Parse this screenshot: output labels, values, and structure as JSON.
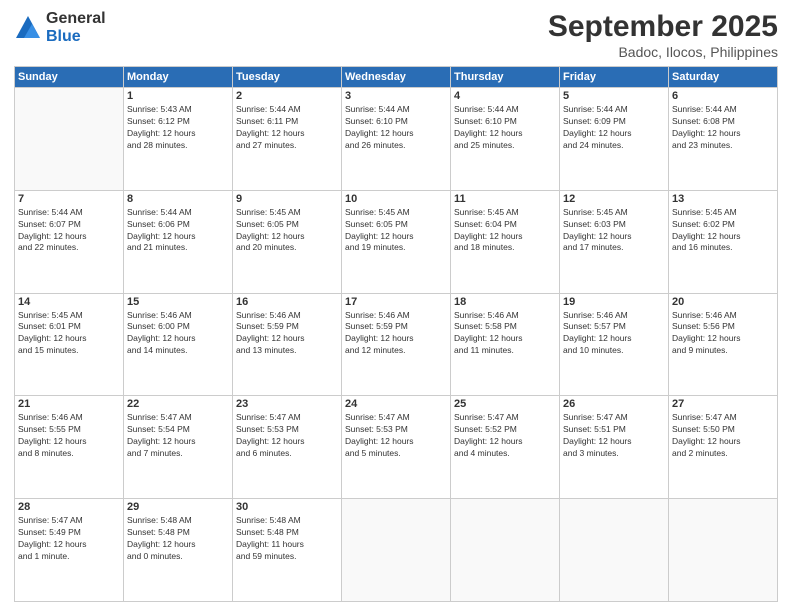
{
  "logo": {
    "general": "General",
    "blue": "Blue"
  },
  "title": "September 2025",
  "location": "Badoc, Ilocos, Philippines",
  "weekdays": [
    "Sunday",
    "Monday",
    "Tuesday",
    "Wednesday",
    "Thursday",
    "Friday",
    "Saturday"
  ],
  "weeks": [
    [
      {
        "day": "",
        "info": ""
      },
      {
        "day": "1",
        "info": "Sunrise: 5:43 AM\nSunset: 6:12 PM\nDaylight: 12 hours\nand 28 minutes."
      },
      {
        "day": "2",
        "info": "Sunrise: 5:44 AM\nSunset: 6:11 PM\nDaylight: 12 hours\nand 27 minutes."
      },
      {
        "day": "3",
        "info": "Sunrise: 5:44 AM\nSunset: 6:10 PM\nDaylight: 12 hours\nand 26 minutes."
      },
      {
        "day": "4",
        "info": "Sunrise: 5:44 AM\nSunset: 6:10 PM\nDaylight: 12 hours\nand 25 minutes."
      },
      {
        "day": "5",
        "info": "Sunrise: 5:44 AM\nSunset: 6:09 PM\nDaylight: 12 hours\nand 24 minutes."
      },
      {
        "day": "6",
        "info": "Sunrise: 5:44 AM\nSunset: 6:08 PM\nDaylight: 12 hours\nand 23 minutes."
      }
    ],
    [
      {
        "day": "7",
        "info": "Sunrise: 5:44 AM\nSunset: 6:07 PM\nDaylight: 12 hours\nand 22 minutes."
      },
      {
        "day": "8",
        "info": "Sunrise: 5:44 AM\nSunset: 6:06 PM\nDaylight: 12 hours\nand 21 minutes."
      },
      {
        "day": "9",
        "info": "Sunrise: 5:45 AM\nSunset: 6:05 PM\nDaylight: 12 hours\nand 20 minutes."
      },
      {
        "day": "10",
        "info": "Sunrise: 5:45 AM\nSunset: 6:05 PM\nDaylight: 12 hours\nand 19 minutes."
      },
      {
        "day": "11",
        "info": "Sunrise: 5:45 AM\nSunset: 6:04 PM\nDaylight: 12 hours\nand 18 minutes."
      },
      {
        "day": "12",
        "info": "Sunrise: 5:45 AM\nSunset: 6:03 PM\nDaylight: 12 hours\nand 17 minutes."
      },
      {
        "day": "13",
        "info": "Sunrise: 5:45 AM\nSunset: 6:02 PM\nDaylight: 12 hours\nand 16 minutes."
      }
    ],
    [
      {
        "day": "14",
        "info": "Sunrise: 5:45 AM\nSunset: 6:01 PM\nDaylight: 12 hours\nand 15 minutes."
      },
      {
        "day": "15",
        "info": "Sunrise: 5:46 AM\nSunset: 6:00 PM\nDaylight: 12 hours\nand 14 minutes."
      },
      {
        "day": "16",
        "info": "Sunrise: 5:46 AM\nSunset: 5:59 PM\nDaylight: 12 hours\nand 13 minutes."
      },
      {
        "day": "17",
        "info": "Sunrise: 5:46 AM\nSunset: 5:59 PM\nDaylight: 12 hours\nand 12 minutes."
      },
      {
        "day": "18",
        "info": "Sunrise: 5:46 AM\nSunset: 5:58 PM\nDaylight: 12 hours\nand 11 minutes."
      },
      {
        "day": "19",
        "info": "Sunrise: 5:46 AM\nSunset: 5:57 PM\nDaylight: 12 hours\nand 10 minutes."
      },
      {
        "day": "20",
        "info": "Sunrise: 5:46 AM\nSunset: 5:56 PM\nDaylight: 12 hours\nand 9 minutes."
      }
    ],
    [
      {
        "day": "21",
        "info": "Sunrise: 5:46 AM\nSunset: 5:55 PM\nDaylight: 12 hours\nand 8 minutes."
      },
      {
        "day": "22",
        "info": "Sunrise: 5:47 AM\nSunset: 5:54 PM\nDaylight: 12 hours\nand 7 minutes."
      },
      {
        "day": "23",
        "info": "Sunrise: 5:47 AM\nSunset: 5:53 PM\nDaylight: 12 hours\nand 6 minutes."
      },
      {
        "day": "24",
        "info": "Sunrise: 5:47 AM\nSunset: 5:53 PM\nDaylight: 12 hours\nand 5 minutes."
      },
      {
        "day": "25",
        "info": "Sunrise: 5:47 AM\nSunset: 5:52 PM\nDaylight: 12 hours\nand 4 minutes."
      },
      {
        "day": "26",
        "info": "Sunrise: 5:47 AM\nSunset: 5:51 PM\nDaylight: 12 hours\nand 3 minutes."
      },
      {
        "day": "27",
        "info": "Sunrise: 5:47 AM\nSunset: 5:50 PM\nDaylight: 12 hours\nand 2 minutes."
      }
    ],
    [
      {
        "day": "28",
        "info": "Sunrise: 5:47 AM\nSunset: 5:49 PM\nDaylight: 12 hours\nand 1 minute."
      },
      {
        "day": "29",
        "info": "Sunrise: 5:48 AM\nSunset: 5:48 PM\nDaylight: 12 hours\nand 0 minutes."
      },
      {
        "day": "30",
        "info": "Sunrise: 5:48 AM\nSunset: 5:48 PM\nDaylight: 11 hours\nand 59 minutes."
      },
      {
        "day": "",
        "info": ""
      },
      {
        "day": "",
        "info": ""
      },
      {
        "day": "",
        "info": ""
      },
      {
        "day": "",
        "info": ""
      }
    ]
  ]
}
